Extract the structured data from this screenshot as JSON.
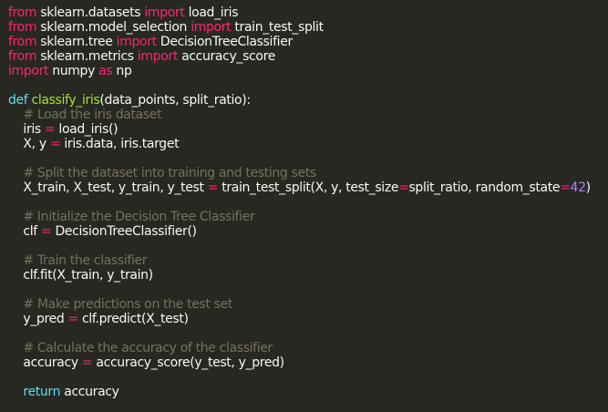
{
  "editor": {
    "colors": {
      "background": "#272822",
      "text": "#f8f8f2",
      "keyword": "#f92672",
      "def_keyword": "#66d9ef",
      "function_name": "#a6e22e",
      "comment": "#75715e",
      "number": "#ae81ff"
    },
    "lines": [
      [
        [
          "kw",
          "from"
        ],
        [
          "pl",
          " sklearn.datasets "
        ],
        [
          "kw",
          "import"
        ],
        [
          "pl",
          " load_iris"
        ]
      ],
      [
        [
          "kw",
          "from"
        ],
        [
          "pl",
          " sklearn.model_selection "
        ],
        [
          "kw",
          "import"
        ],
        [
          "pl",
          " train_test_split"
        ]
      ],
      [
        [
          "kw",
          "from"
        ],
        [
          "pl",
          " sklearn.tree "
        ],
        [
          "kw",
          "import"
        ],
        [
          "pl",
          " DecisionTreeClassifier"
        ]
      ],
      [
        [
          "kw",
          "from"
        ],
        [
          "pl",
          " sklearn.metrics "
        ],
        [
          "kw",
          "import"
        ],
        [
          "pl",
          " accuracy_score"
        ]
      ],
      [
        [
          "kw",
          "import"
        ],
        [
          "pl",
          " numpy "
        ],
        [
          "kw",
          "as"
        ],
        [
          "pl",
          " np"
        ]
      ],
      [],
      [
        [
          "def",
          "def"
        ],
        [
          "pl",
          " "
        ],
        [
          "fn",
          "classify_iris"
        ],
        [
          "pl",
          "(data_points, split_ratio):"
        ]
      ],
      [
        [
          "pl",
          "    "
        ],
        [
          "cm",
          "# Load the iris dataset"
        ]
      ],
      [
        [
          "pl",
          "    iris "
        ],
        [
          "kw",
          "="
        ],
        [
          "pl",
          " load_iris()"
        ]
      ],
      [
        [
          "pl",
          "    X, y "
        ],
        [
          "kw",
          "="
        ],
        [
          "pl",
          " iris.data, iris.target"
        ]
      ],
      [],
      [
        [
          "pl",
          "    "
        ],
        [
          "cm",
          "# Split the dataset into training and testing sets"
        ]
      ],
      [
        [
          "pl",
          "    X_train, X_test, y_train, y_test "
        ],
        [
          "kw",
          "="
        ],
        [
          "pl",
          " train_test_split(X, y, test_size"
        ],
        [
          "kw",
          "="
        ],
        [
          "pl",
          "split_ratio, random_state"
        ],
        [
          "kw",
          "="
        ],
        [
          "num",
          "42"
        ],
        [
          "pl",
          ")"
        ]
      ],
      [],
      [
        [
          "pl",
          "    "
        ],
        [
          "cm",
          "# Initialize the Decision Tree Classifier"
        ]
      ],
      [
        [
          "pl",
          "    clf "
        ],
        [
          "kw",
          "="
        ],
        [
          "pl",
          " DecisionTreeClassifier()"
        ]
      ],
      [],
      [
        [
          "pl",
          "    "
        ],
        [
          "cm",
          "# Train the classifier"
        ]
      ],
      [
        [
          "pl",
          "    clf.fit(X_train, y_train)"
        ]
      ],
      [],
      [
        [
          "pl",
          "    "
        ],
        [
          "cm",
          "# Make predictions on the test set"
        ]
      ],
      [
        [
          "pl",
          "    y_pred "
        ],
        [
          "kw",
          "="
        ],
        [
          "pl",
          " clf.predict(X_test)"
        ]
      ],
      [],
      [
        [
          "pl",
          "    "
        ],
        [
          "cm",
          "# Calculate the accuracy of the classifier"
        ]
      ],
      [
        [
          "pl",
          "    accuracy "
        ],
        [
          "kw",
          "="
        ],
        [
          "pl",
          " accuracy_score(y_test, y_pred)"
        ]
      ],
      [],
      [
        [
          "pl",
          "    "
        ],
        [
          "ret",
          "return"
        ],
        [
          "pl",
          " accuracy"
        ]
      ]
    ]
  }
}
